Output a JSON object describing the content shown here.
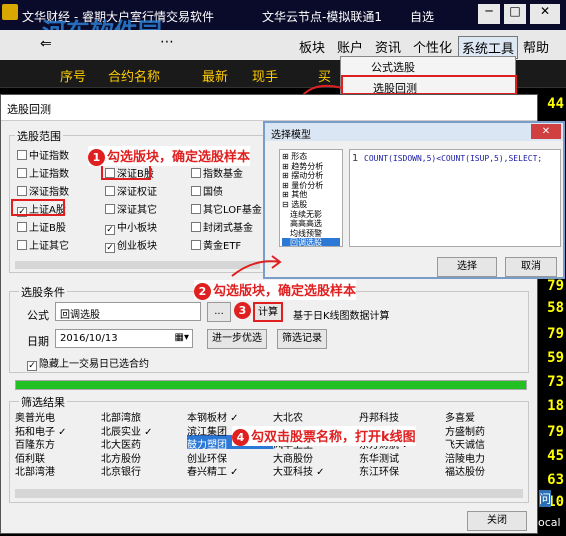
{
  "app": {
    "title": "文华财经 - 睿期大户室行情交易软件",
    "server": "文华云节点-模拟联通1",
    "watchlist": "自选",
    "watermark": "河东软件园",
    "watermark_url": "www.pc0359.cn"
  },
  "menu": {
    "block": "板块",
    "account": "账户",
    "news": "资讯",
    "personalize": "个性化",
    "systools": "系统工具",
    "help": "帮助"
  },
  "columns": {
    "seq": "序号",
    "name": "合约名称",
    "latest": "最新",
    "hand": "现手",
    "buy": "买"
  },
  "right_numbers": [
    "44",
    "79",
    "58",
    "79",
    "59",
    "73",
    "18",
    "79",
    "45",
    "63",
    "10",
    "70"
  ],
  "dropdown": {
    "formula_pick": "公式选股",
    "backtest": "选股回测"
  },
  "dialog": {
    "title": "选股回测",
    "scope_label": "选股范围",
    "scope": [
      {
        "label": "中证指数",
        "checked": false
      },
      {
        "label": "深证A股",
        "checked": true
      },
      {
        "label": "风险警示",
        "checked": false
      },
      {
        "label": "上证指数",
        "checked": false
      },
      {
        "label": "深证B股",
        "checked": false
      },
      {
        "label": "指数基金",
        "checked": false
      },
      {
        "label": "深证指数",
        "checked": false
      },
      {
        "label": "深证权证",
        "checked": false
      },
      {
        "label": "国债",
        "checked": false
      },
      {
        "label": "上证A股",
        "checked": true
      },
      {
        "label": "深证其它",
        "checked": false
      },
      {
        "label": "其它LOF基金",
        "checked": false
      },
      {
        "label": "上证B股",
        "checked": false
      },
      {
        "label": "中小板块",
        "checked": true
      },
      {
        "label": "封闭式基金",
        "checked": false
      },
      {
        "label": "上证其它",
        "checked": false
      },
      {
        "label": "创业板块",
        "checked": true
      },
      {
        "label": "黄金ETF",
        "checked": false
      }
    ],
    "cond_label": "选股条件",
    "formula_label": "公式",
    "formula_value": "回调选股",
    "ellipsis": "...",
    "calc": "计算",
    "calc_note": "基于日K线图数据计算",
    "date_label": "日期",
    "date_value": "2016/10/13",
    "further": "进一步优选",
    "filter_record": "筛选记录",
    "hide_prev": "隐藏上一交易日已选合约",
    "hide_prev_checked": true,
    "progress": 1.0,
    "results_label": "筛选结果",
    "results": [
      [
        "奥普光电",
        "北部湾旅",
        "本钢板材 ✓",
        "大北农",
        "丹邦科技",
        "多喜爱"
      ],
      [
        "拓和电子 ✓",
        "北辰实业 ✓",
        "滨江集团",
        "大东南 ✓",
        "大连热电",
        "方盛制药"
      ],
      [
        "百隆东方",
        "北大医药",
        "鼓力塑团",
        "风华卫生",
        "东方财航 ✓",
        "飞天诚信"
      ],
      [
        "佰利联",
        "北方股份",
        "创业环保",
        "大商股份",
        "东华测试",
        "涪陵电力"
      ],
      [
        "北部湾港",
        "北京银行",
        "春兴精工 ✓",
        "大亚科技 ✓",
        "东江环保",
        "福达股份"
      ]
    ],
    "close": "关闭"
  },
  "model": {
    "title": "选择模型",
    "tree": [
      "⊞ 形态",
      "⊞ 趋势分析",
      "⊞ 摆动分析",
      "⊞ 量价分析",
      "⊞ 其他",
      "⊟ 选股",
      "连续无影",
      "高高高选",
      "均线预警",
      "回调选股"
    ],
    "line": "1",
    "code": "COUNT(ISDOWN,5)<COUNT(ISUP,5),SELECT;",
    "choose": "选择",
    "cancel": "取消"
  },
  "annotations": {
    "a1": "勾选版块，确定选股样本",
    "a2": "勾选版块，确定选股样本",
    "a3": "3",
    "a4": "勾双击股票名称，打开k线图",
    "n1": "1",
    "n2": "2",
    "n4": "4"
  },
  "bottom_right": {
    "q": "问",
    "local": "ocal"
  }
}
